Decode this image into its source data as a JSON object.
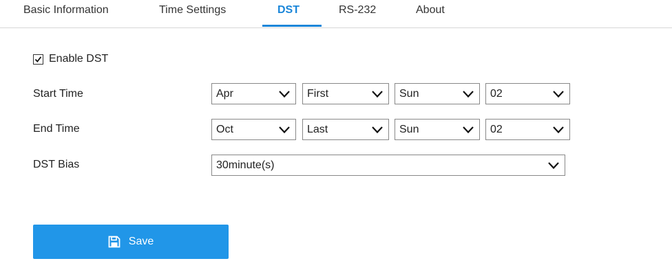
{
  "tabs": [
    {
      "label": "Basic Information"
    },
    {
      "label": "Time Settings"
    },
    {
      "label": "DST"
    },
    {
      "label": "RS-232"
    },
    {
      "label": "About"
    }
  ],
  "active_tab": "DST",
  "enable_dst": {
    "label": "Enable DST",
    "checked": true
  },
  "start_time": {
    "label": "Start Time",
    "month": "Apr",
    "week": "First",
    "day": "Sun",
    "hour": "02"
  },
  "end_time": {
    "label": "End Time",
    "month": "Oct",
    "week": "Last",
    "day": "Sun",
    "hour": "02"
  },
  "dst_bias": {
    "label": "DST Bias",
    "value": "30minute(s)"
  },
  "save_button": {
    "label": "Save"
  },
  "colors": {
    "accent": "#1a86d9",
    "button": "#2196e8"
  }
}
